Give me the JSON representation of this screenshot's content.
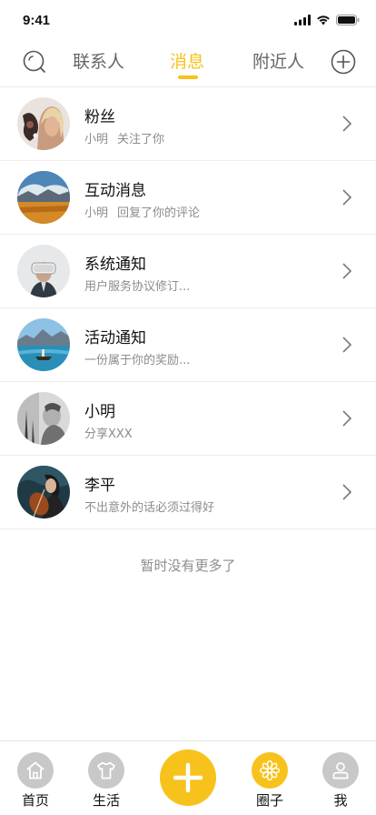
{
  "status_bar": {
    "time": "9:41"
  },
  "top_nav": {
    "tabs": [
      {
        "label": "联系人",
        "active": false
      },
      {
        "label": "消息",
        "active": true
      },
      {
        "label": "附近人",
        "active": false
      }
    ],
    "search_icon": "search-icon",
    "add_icon": "plus-circle-icon"
  },
  "messages": [
    {
      "title": "粉丝",
      "subtitle_name": "小明",
      "subtitle_text": "关注了你"
    },
    {
      "title": "互动消息",
      "subtitle_name": "小明",
      "subtitle_text": "回复了你的评论"
    },
    {
      "title": "系统通知",
      "subtitle_text": "用户服务协议修订..."
    },
    {
      "title": "活动通知",
      "subtitle_text": "一份属于你的奖励..."
    },
    {
      "title": "小明",
      "subtitle_text": "分享XXX"
    },
    {
      "title": "李平",
      "subtitle_text": "不出意外的话必须过得好"
    }
  ],
  "no_more_text": "暂时没有更多了",
  "bottom_bar": {
    "items": [
      {
        "label": "首页",
        "icon": "home-icon"
      },
      {
        "label": "生活",
        "icon": "shirt-icon"
      },
      {
        "label": "",
        "icon": "plus-icon"
      },
      {
        "label": "圈子",
        "icon": "flower-icon"
      },
      {
        "label": "我",
        "icon": "person-icon"
      }
    ]
  },
  "colors": {
    "accent": "#f7c21b",
    "text": "#111111",
    "muted": "#8c8c8c",
    "divider": "#ececec"
  }
}
